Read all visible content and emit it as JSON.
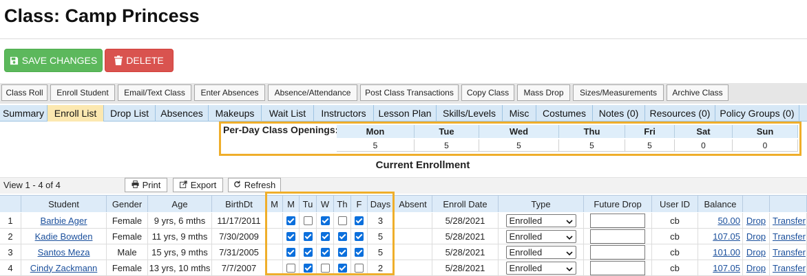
{
  "page": {
    "title": "Class: Camp Princess"
  },
  "actions": {
    "save": "SAVE CHANGES",
    "delete": "DELETE"
  },
  "toolbar": [
    "Class Roll",
    "Enroll Student",
    "Email/Text Class",
    "Enter Absences",
    "Absence/Attendance",
    "Post Class Transactions",
    "Copy Class",
    "Mass Drop",
    "Sizes/Measurements",
    "Archive Class"
  ],
  "tabs": {
    "items": [
      "Summary",
      "Enroll List",
      "Drop List",
      "Absences",
      "Makeups",
      "Wait List",
      "Instructors",
      "Lesson Plan",
      "Skills/Levels",
      "Misc",
      "Costumes",
      "Notes (0)",
      "Resources (0)",
      "Policy Groups (0)"
    ],
    "active": "Enroll List"
  },
  "openings": {
    "label": "Per-Day Class Openings:",
    "days": [
      "Mon",
      "Tue",
      "Wed",
      "Thu",
      "Fri",
      "Sat",
      "Sun"
    ],
    "values": [
      "5",
      "5",
      "5",
      "5",
      "5",
      "0",
      "0"
    ]
  },
  "enrollment": {
    "title": "Current Enrollment",
    "view_count": "View 1 - 4 of 4",
    "print": "Print",
    "export": "Export",
    "refresh": "Refresh",
    "columns": [
      "",
      "Student",
      "Gender",
      "Age",
      "BirthDt",
      "M",
      "M",
      "Tu",
      "W",
      "Th",
      "F",
      "Days",
      "Absent",
      "Enroll Date",
      "Type",
      "Future Drop",
      "User ID",
      "Balance",
      "",
      ""
    ],
    "rows": [
      {
        "num": "1",
        "student": "Barbie Ager",
        "gender": "Female",
        "age": "9 yrs, 6 mths",
        "birth": "11/17/2011",
        "days": [
          true,
          false,
          true,
          false,
          true
        ],
        "day_count": "3",
        "absent": "",
        "enroll_date": "5/28/2021",
        "type": "Enrolled",
        "future_drop": "",
        "user_id": "cb",
        "balance": "50.00",
        "drop": "Drop",
        "transfer": "Transfer"
      },
      {
        "num": "2",
        "student": "Kadie Bowden",
        "gender": "Female",
        "age": "11 yrs, 9 mths",
        "birth": "7/30/2009",
        "days": [
          true,
          true,
          true,
          true,
          true
        ],
        "day_count": "5",
        "absent": "",
        "enroll_date": "5/28/2021",
        "type": "Enrolled",
        "future_drop": "",
        "user_id": "cb",
        "balance": "107.05",
        "drop": "Drop",
        "transfer": "Transfer"
      },
      {
        "num": "3",
        "student": "Santos Meza",
        "gender": "Male",
        "age": "15 yrs, 9 mths",
        "birth": "7/31/2005",
        "days": [
          true,
          true,
          true,
          true,
          true
        ],
        "day_count": "5",
        "absent": "",
        "enroll_date": "5/28/2021",
        "type": "Enrolled",
        "future_drop": "",
        "user_id": "cb",
        "balance": "101.00",
        "drop": "Drop",
        "transfer": "Transfer"
      },
      {
        "num": "4",
        "student": "Cindy Zackmann",
        "gender": "Female",
        "age": "13 yrs, 10 mths",
        "birth": "7/7/2007",
        "days": [
          false,
          true,
          false,
          true,
          false
        ],
        "day_count": "2",
        "absent": "",
        "enroll_date": "5/28/2021",
        "type": "Enrolled",
        "future_drop": "",
        "user_id": "cb",
        "balance": "107.05",
        "drop": "Drop",
        "transfer": "Transfer"
      }
    ]
  },
  "colors": {
    "save": "#5cb85c",
    "delete": "#d9534f",
    "highlight": "#efae2a",
    "active_tab": "#fce8b0",
    "header": "#ddebf8",
    "link": "#1a4f9c"
  },
  "icons": {
    "save": "floppy-disk-icon",
    "delete": "trash-icon",
    "print": "printer-icon",
    "export": "export-icon",
    "refresh": "refresh-icon",
    "dropdown": "chevron-down-icon"
  }
}
